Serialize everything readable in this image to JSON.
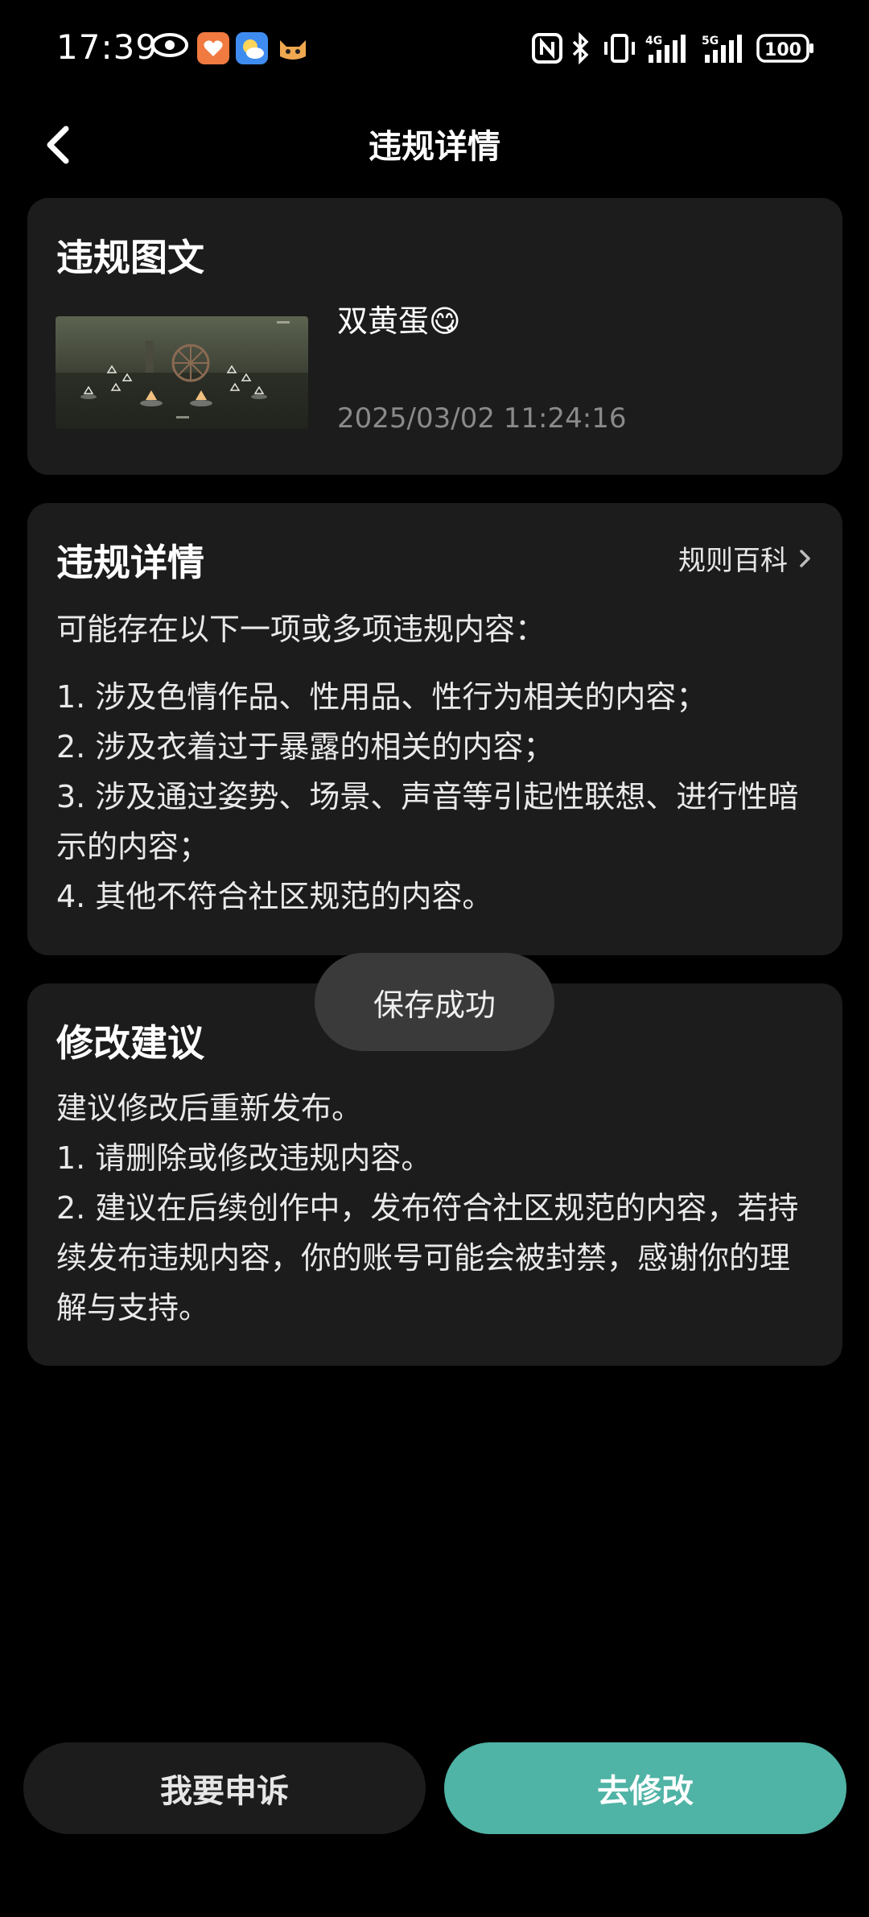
{
  "status_bar": {
    "time": "17:39",
    "battery": "100",
    "icons": [
      "eye-icon",
      "app-icon",
      "app-icon",
      "app-icon",
      "nfc-icon",
      "bluetooth-icon",
      "vibrate-icon",
      "signal-4g-icon",
      "signal-5g-icon",
      "battery-icon"
    ]
  },
  "header": {
    "title": "违规详情"
  },
  "post_card": {
    "title": "违规图文",
    "post_title": "双黄蛋😋",
    "post_time": "2025/03/02 11:24:16"
  },
  "violation_card": {
    "title": "违规详情",
    "rules_link": "规则百科",
    "intro": "可能存在以下一项或多项违规内容：",
    "items": [
      "1. 涉及色情作品、性用品、性行为相关的内容；",
      "2. 涉及衣着过于暴露的相关的内容；",
      "3. 涉及通过姿势、场景、声音等引起性联想、进行性暗示的内容；",
      "4. 其他不符合社区规范的内容。"
    ]
  },
  "suggestion_card": {
    "title": "修改建议",
    "lines": [
      "建议修改后重新发布。",
      "1. 请删除或修改违规内容。",
      "2. 建议在后续创作中，发布符合社区规范的内容，若持续发布违规内容，你的账号可能会被封禁，感谢你的理解与支持。"
    ]
  },
  "toast": {
    "text": "保存成功"
  },
  "actions": {
    "appeal": "我要申诉",
    "edit": "去修改"
  },
  "colors": {
    "accent": "#4fb3a5",
    "card": "#1c1c1c",
    "background": "#000000"
  }
}
